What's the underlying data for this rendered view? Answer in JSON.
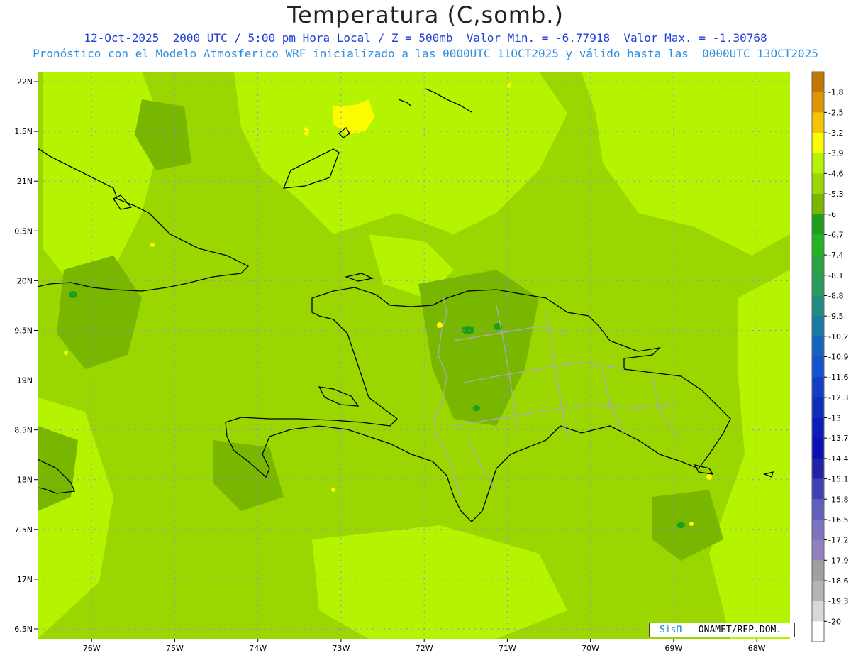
{
  "header": {
    "title": "Temperatura (C,somb.)",
    "line1": "12-Oct-2025  2000 UTC / 5:00 pm Hora Local / Z = 500mb  Valor Min. = -6.77918  Valor Max. = -1.30768",
    "line2": "Pronóstico con el Modelo Atmosferico WRF inicializado a las 0000UTC_11OCT2025 y válido hasta las  0000UTC_13OCT2025"
  },
  "map": {
    "lon_range": [
      -76.65,
      -67.6
    ],
    "lat_range": [
      16.4,
      22.1
    ],
    "lat_ticks": [
      "22N",
      "1.5N",
      "21N",
      "0.5N",
      "20N",
      "9.5N",
      "19N",
      "8.5N",
      "18N",
      "7.5N",
      "17N",
      "6.5N"
    ],
    "lon_ticks": [
      "76W",
      "75W",
      "74W",
      "73W",
      "72W",
      "71W",
      "70W",
      "69W",
      "68W"
    ],
    "background_color": "#9ad700"
  },
  "legend": {
    "labels": [
      "-1.8",
      "-2.5",
      "-3.2",
      "-3.9",
      "-4.6",
      "-5.3",
      "-6",
      "-6.7",
      "-7.4",
      "-8.1",
      "-8.8",
      "-9.5",
      "-10.2",
      "-10.9",
      "-11.6",
      "-12.3",
      "-13",
      "-13.7",
      "-14.4",
      "-15.1",
      "-15.8",
      "-16.5",
      "-17.2",
      "-17.9",
      "-18.6",
      "-19.3",
      "-20"
    ],
    "colors": [
      "#c07800",
      "#e09400",
      "#f4c400",
      "#fcfc00",
      "#b4f400",
      "#9ad700",
      "#78b600",
      "#1e9e1a",
      "#22b422",
      "#2aa244",
      "#2a9a5e",
      "#1e8c80",
      "#1a7aa4",
      "#1464c0",
      "#1254d0",
      "#1040c8",
      "#0c30bc",
      "#0a1cbc",
      "#0a10b4",
      "#2222a8",
      "#4040b4",
      "#6060bc",
      "#7c74c0",
      "#9080c0",
      "#a0a0a0",
      "#b4b4b4",
      "#d8d8d8",
      "#ffffff"
    ]
  },
  "credit": {
    "brand": "SisΠ",
    "rest": " - ONAMET/REP.DOM."
  }
}
